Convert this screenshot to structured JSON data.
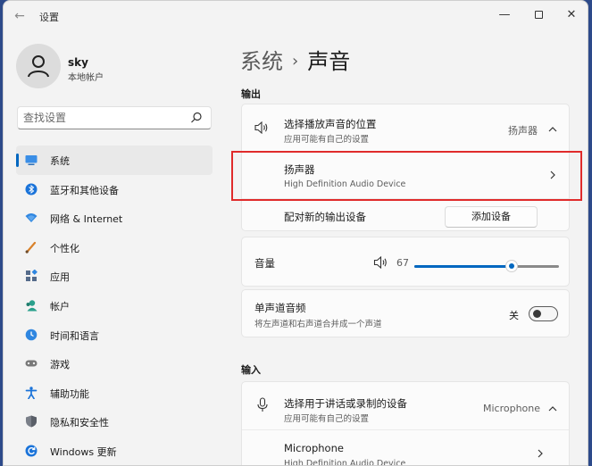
{
  "window": {
    "title": "设置"
  },
  "user": {
    "name": "sky",
    "type": "本地帐户"
  },
  "search": {
    "placeholder": "查找设置"
  },
  "sidebar": {
    "items": [
      {
        "label": "系统",
        "icon": "system-icon",
        "active": true
      },
      {
        "label": "蓝牙和其他设备",
        "icon": "bluetooth-icon"
      },
      {
        "label": "网络 & Internet",
        "icon": "network-icon"
      },
      {
        "label": "个性化",
        "icon": "personalization-icon"
      },
      {
        "label": "应用",
        "icon": "apps-icon"
      },
      {
        "label": "帐户",
        "icon": "accounts-icon"
      },
      {
        "label": "时间和语言",
        "icon": "time-language-icon"
      },
      {
        "label": "游戏",
        "icon": "gaming-icon"
      },
      {
        "label": "辅助功能",
        "icon": "accessibility-icon"
      },
      {
        "label": "隐私和安全性",
        "icon": "privacy-icon"
      },
      {
        "label": "Windows 更新",
        "icon": "windows-update-icon"
      }
    ]
  },
  "breadcrumb": {
    "parent": "系统",
    "separator": "›",
    "current": "声音"
  },
  "output": {
    "section_title": "输出",
    "choose_title": "选择播放声音的位置",
    "choose_sub": "应用可能有自己的设置",
    "choose_value": "扬声器",
    "device_name": "扬声器",
    "device_desc": "High Definition Audio Device",
    "pair_label": "配对新的输出设备",
    "add_button": "添加设备"
  },
  "volume": {
    "label": "音量",
    "value": "67",
    "level": 0.67
  },
  "mono": {
    "title": "单声道音频",
    "sub": "将左声道和右声道合并成一个声道",
    "state": "关"
  },
  "input": {
    "section_title": "输入",
    "choose_title": "选择用于讲话或录制的设备",
    "choose_sub": "应用可能有自己的设置",
    "choose_value": "Microphone",
    "device_name": "Microphone",
    "device_desc": "High Definition Audio Device"
  },
  "colors": {
    "accent": "#0067c0",
    "highlight": "#e02b2b"
  }
}
